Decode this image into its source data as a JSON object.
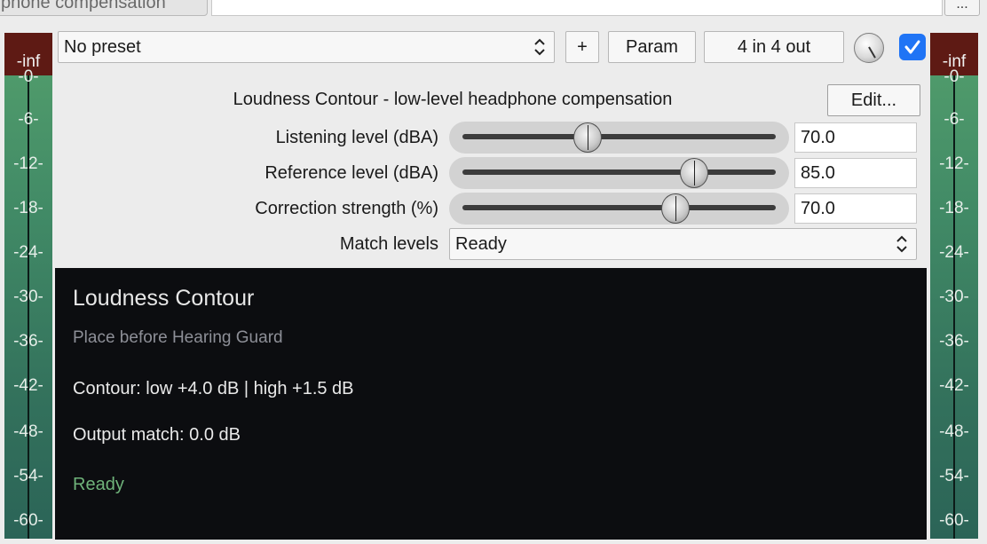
{
  "window": {
    "title_fragment": "phone compensation",
    "more_label": "..."
  },
  "toolbar": {
    "preset_value": "No preset",
    "add_label": "+",
    "param_label": "Param",
    "io_label": "4 in 4 out",
    "enabled": true
  },
  "plugin": {
    "title": "Loudness Contour - low-level headphone compensation",
    "edit_label": "Edit..."
  },
  "params": [
    {
      "label": "Listening level (dBA)",
      "value": "70.0",
      "position": 0.4
    },
    {
      "label": "Reference level (dBA)",
      "value": "85.0",
      "position": 0.74
    },
    {
      "label": "Correction strength (%)",
      "value": "70.0",
      "position": 0.68
    }
  ],
  "match": {
    "label": "Match levels",
    "value": "Ready"
  },
  "info": {
    "title": "Loudness Contour",
    "subtitle": "Place before Hearing Guard",
    "contour": "Contour: low +4.0 dB | high +1.5 dB",
    "output_match": "Output match: 0.0 dB",
    "status": "Ready"
  },
  "meters": {
    "left": {
      "peak": "-inf",
      "ticks": [
        "-0-",
        "-6-",
        "-12-",
        "-18-",
        "-24-",
        "-30-",
        "-36-",
        "-42-",
        "-48-",
        "-54-",
        "-60-"
      ]
    },
    "right": {
      "peak": "-inf",
      "ticks": [
        "-0-",
        "-6-",
        "-12-",
        "-18-",
        "-24-",
        "-30-",
        "-36-",
        "-42-",
        "-48-",
        "-54-",
        "-60-"
      ]
    }
  },
  "colors": {
    "meter_peak": "#5e1a14",
    "meter_bar": "#3a6e5c",
    "checkbox": "#1f74f5",
    "info_bg": "#0c0d10",
    "status_ok": "#6fb37a"
  }
}
